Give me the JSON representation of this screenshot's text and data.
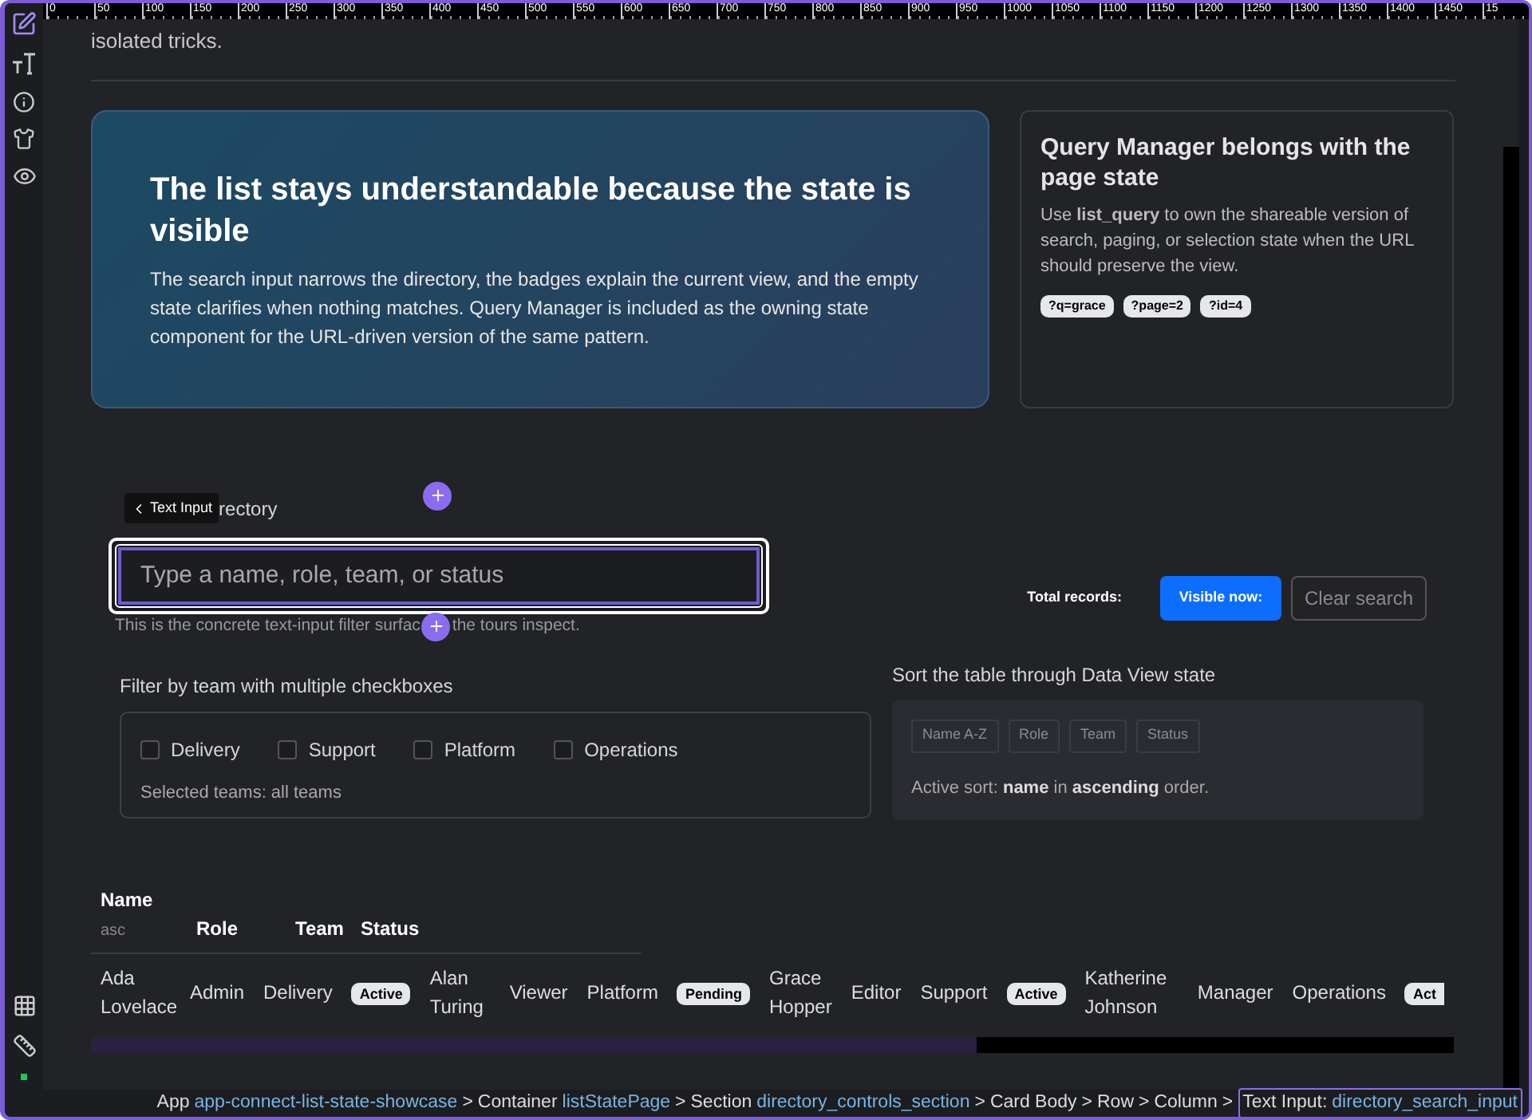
{
  "tools": [
    {
      "kind": "edit",
      "selected": true
    },
    {
      "kind": "text",
      "selected": false
    },
    {
      "kind": "info",
      "selected": false
    },
    {
      "kind": "shirt",
      "selected": false
    },
    {
      "kind": "eye",
      "selected": false
    }
  ],
  "bottom_tools": [
    {
      "kind": "grid"
    },
    {
      "kind": "ruler"
    }
  ],
  "status_on": true,
  "ruler": {
    "labels": [
      "0",
      "50",
      "100",
      "150",
      "200",
      "250",
      "300",
      "350",
      "400",
      "450",
      "500",
      "550",
      "600",
      "650",
      "700",
      "750",
      "800",
      "850",
      "900",
      "950",
      "1000",
      "1050",
      "1100",
      "1150",
      "1200",
      "1250",
      "1300",
      "1350",
      "1400",
      "1450",
      "15"
    ]
  },
  "intro_text": "isolated tricks.",
  "hero": {
    "title": "The list stays understandable because the state is visible",
    "body": "The search input narrows the directory, the badges explain the current view, and the empty state clarifies when nothing matches. Query Manager is included as the owning state component for the URL-driven version of the same pattern."
  },
  "side_card": {
    "title": "Query Manager belongs with the page state",
    "body": "Use **list_query** to own the shareable version of search, paging, or selection state when the URL should preserve the view.",
    "chips": [
      "?q=grace",
      "?page=2",
      "?id=4"
    ]
  },
  "search": {
    "tooltip": "Text Input",
    "label": "rectory",
    "placeholder": "Type a name, role, team, or status",
    "helper_before": "This is the concrete text-input filter surfac",
    "helper_after": "the tours inspect."
  },
  "stats": {
    "total_label": "Total records:",
    "visible_label": "Visible now:",
    "clear_label": "Clear search"
  },
  "team_filter": {
    "label": "Filter by team with multiple checkboxes",
    "options": [
      {
        "label": "Delivery",
        "checked": false
      },
      {
        "label": "Support",
        "checked": false
      },
      {
        "label": "Platform",
        "checked": false
      },
      {
        "label": "Operations",
        "checked": false
      }
    ],
    "summary": "Selected teams: all teams"
  },
  "sort": {
    "label": "Sort the table through Data View state",
    "buttons": [
      {
        "label": "Name A-Z",
        "disabled": true
      },
      {
        "label": "Role",
        "disabled": true
      },
      {
        "label": "Team",
        "disabled": true
      },
      {
        "label": "Status",
        "disabled": true
      }
    ],
    "summary": "Active sort: **name** in **ascending** order."
  },
  "table": {
    "columns": [
      {
        "label": "Name",
        "sub": "asc"
      },
      {
        "label": "Role"
      },
      {
        "label": "Team"
      },
      {
        "label": "Status"
      }
    ],
    "records": [
      {
        "name": "Ada Lovelace",
        "role": "Admin",
        "team": "Delivery",
        "status": "Active"
      },
      {
        "name": "Alan Turing",
        "role": "Viewer",
        "team": "Platform",
        "status": "Pending"
      },
      {
        "name": "Grace Hopper",
        "role": "Editor",
        "team": "Support",
        "status": "Active"
      },
      {
        "name": "Katherine Johnson",
        "role": "Manager",
        "team": "Operations",
        "status": "Act"
      }
    ]
  },
  "breadcrumb": [
    {
      "type": "App",
      "id": "app-connect-list-state-showcase",
      "selected": false
    },
    {
      "sep": ">",
      "type": "Container",
      "id": "listStatePage",
      "selected": false
    },
    {
      "sep": ">",
      "type": "Section",
      "id": "directory_controls_section",
      "selected": false
    },
    {
      "sep": ">",
      "type": "Card Body",
      "selected": false
    },
    {
      "sep": ">",
      "type": "Row",
      "selected": false
    },
    {
      "sep": ">",
      "type": "Column",
      "selected": false
    },
    {
      "sep": ">",
      "type": "Text Input:",
      "id": "directory_search_input",
      "selected": true
    }
  ]
}
